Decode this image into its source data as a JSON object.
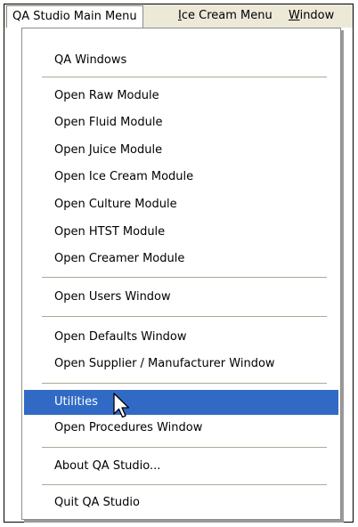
{
  "menubar": {
    "items": [
      {
        "label": "QA Studio Main Menu"
      },
      {
        "label_first": "I",
        "label_rest": "ce Cream Menu"
      },
      {
        "label_first": "W",
        "label_rest": "indow"
      }
    ]
  },
  "menu": {
    "items": [
      "QA Windows",
      "Open Raw Module",
      "Open Fluid Module",
      "Open Juice Module",
      "Open Ice Cream Module",
      "Open Culture Module",
      "Open HTST Module",
      "Open Creamer Module",
      "Open Users Window",
      "Open Defaults Window",
      "Open Supplier / Manufacturer Window",
      "Utilities",
      "Open Procedures Window",
      "About QA Studio...",
      "Quit QA Studio"
    ],
    "highlighted_item": "Utilities",
    "highlight_color": "#316ac5"
  }
}
